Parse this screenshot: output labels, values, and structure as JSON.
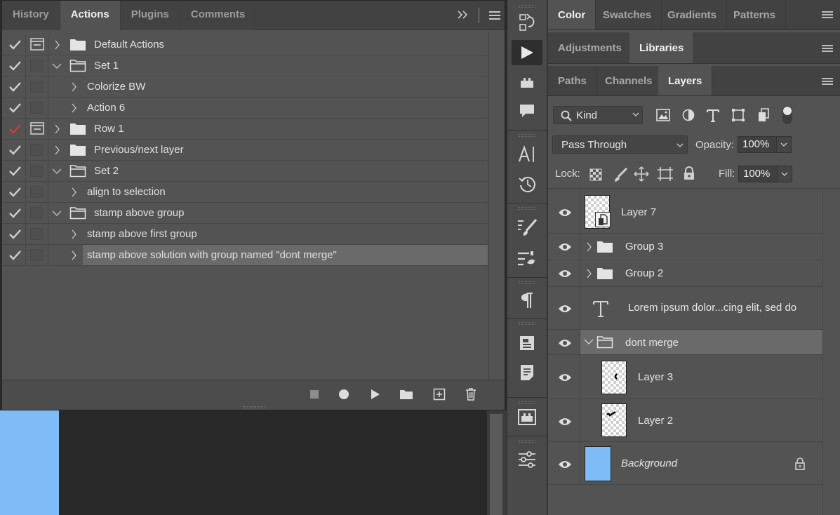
{
  "actions_panel": {
    "tabs": [
      "History",
      "Actions",
      "Plugins",
      "Comments"
    ],
    "active_tab": "Actions",
    "rows": [
      {
        "label": "Default Actions",
        "type": "set",
        "expanded": false,
        "dialog": true,
        "check_color": "#d0d0d0"
      },
      {
        "label": "Set 1",
        "type": "set",
        "expanded": true,
        "dialog": false,
        "check_color": "#d0d0d0"
      },
      {
        "label": "Colorize BW",
        "type": "action",
        "dialog": false,
        "check_color": "#d0d0d0"
      },
      {
        "label": "Action 6",
        "type": "action",
        "dialog": false,
        "check_color": "#d0d0d0"
      },
      {
        "label": "Row 1",
        "type": "set",
        "expanded": false,
        "dialog": true,
        "check_color": "#d23b3b"
      },
      {
        "label": "Previous/next layer",
        "type": "set",
        "expanded": false,
        "dialog": false,
        "check_color": "#d0d0d0"
      },
      {
        "label": "Set 2",
        "type": "set",
        "expanded": true,
        "dialog": false,
        "check_color": "#d0d0d0"
      },
      {
        "label": "align to selection",
        "type": "action",
        "dialog": false,
        "check_color": "#d0d0d0"
      },
      {
        "label": "stamp above group",
        "type": "set",
        "expanded": true,
        "dialog": false,
        "check_color": "#d0d0d0"
      },
      {
        "label": "stamp above first group",
        "type": "action",
        "dialog": false,
        "check_color": "#d0d0d0"
      },
      {
        "label": "stamp above solution with group named \"dont merge\"",
        "type": "action",
        "dialog": false,
        "selected": true,
        "check_color": "#d0d0d0"
      }
    ],
    "footer_icons": [
      "stop-icon",
      "record-icon",
      "play-icon",
      "new-set-icon",
      "new-action-icon",
      "delete-icon"
    ]
  },
  "right": {
    "tabs_row1": [
      "Color",
      "Swatches",
      "Gradients",
      "Patterns"
    ],
    "tabs_row2": [
      "Adjustments",
      "Libraries"
    ],
    "tabs_row3": [
      "Paths",
      "Channels",
      "Layers"
    ],
    "filter_kind": "Kind",
    "blend_mode": "Pass Through",
    "opacity_label": "Opacity:",
    "opacity_value": "100%",
    "lock_label": "Lock:",
    "fill_label": "Fill:",
    "fill_value": "100%",
    "layers": [
      {
        "name": "Layer 7",
        "kind": "smart-object"
      },
      {
        "name": "Group 3",
        "kind": "group"
      },
      {
        "name": "Group 2",
        "kind": "group"
      },
      {
        "name": "Lorem ipsum dolor...cing elit, sed do",
        "kind": "text"
      },
      {
        "name": "dont merge",
        "kind": "group-open",
        "selected": true
      },
      {
        "name": "Layer 3",
        "kind": "pixel"
      },
      {
        "name": "Layer 2",
        "kind": "pixel"
      },
      {
        "name": "Background",
        "kind": "background",
        "color": "#7fbbf6"
      }
    ]
  }
}
